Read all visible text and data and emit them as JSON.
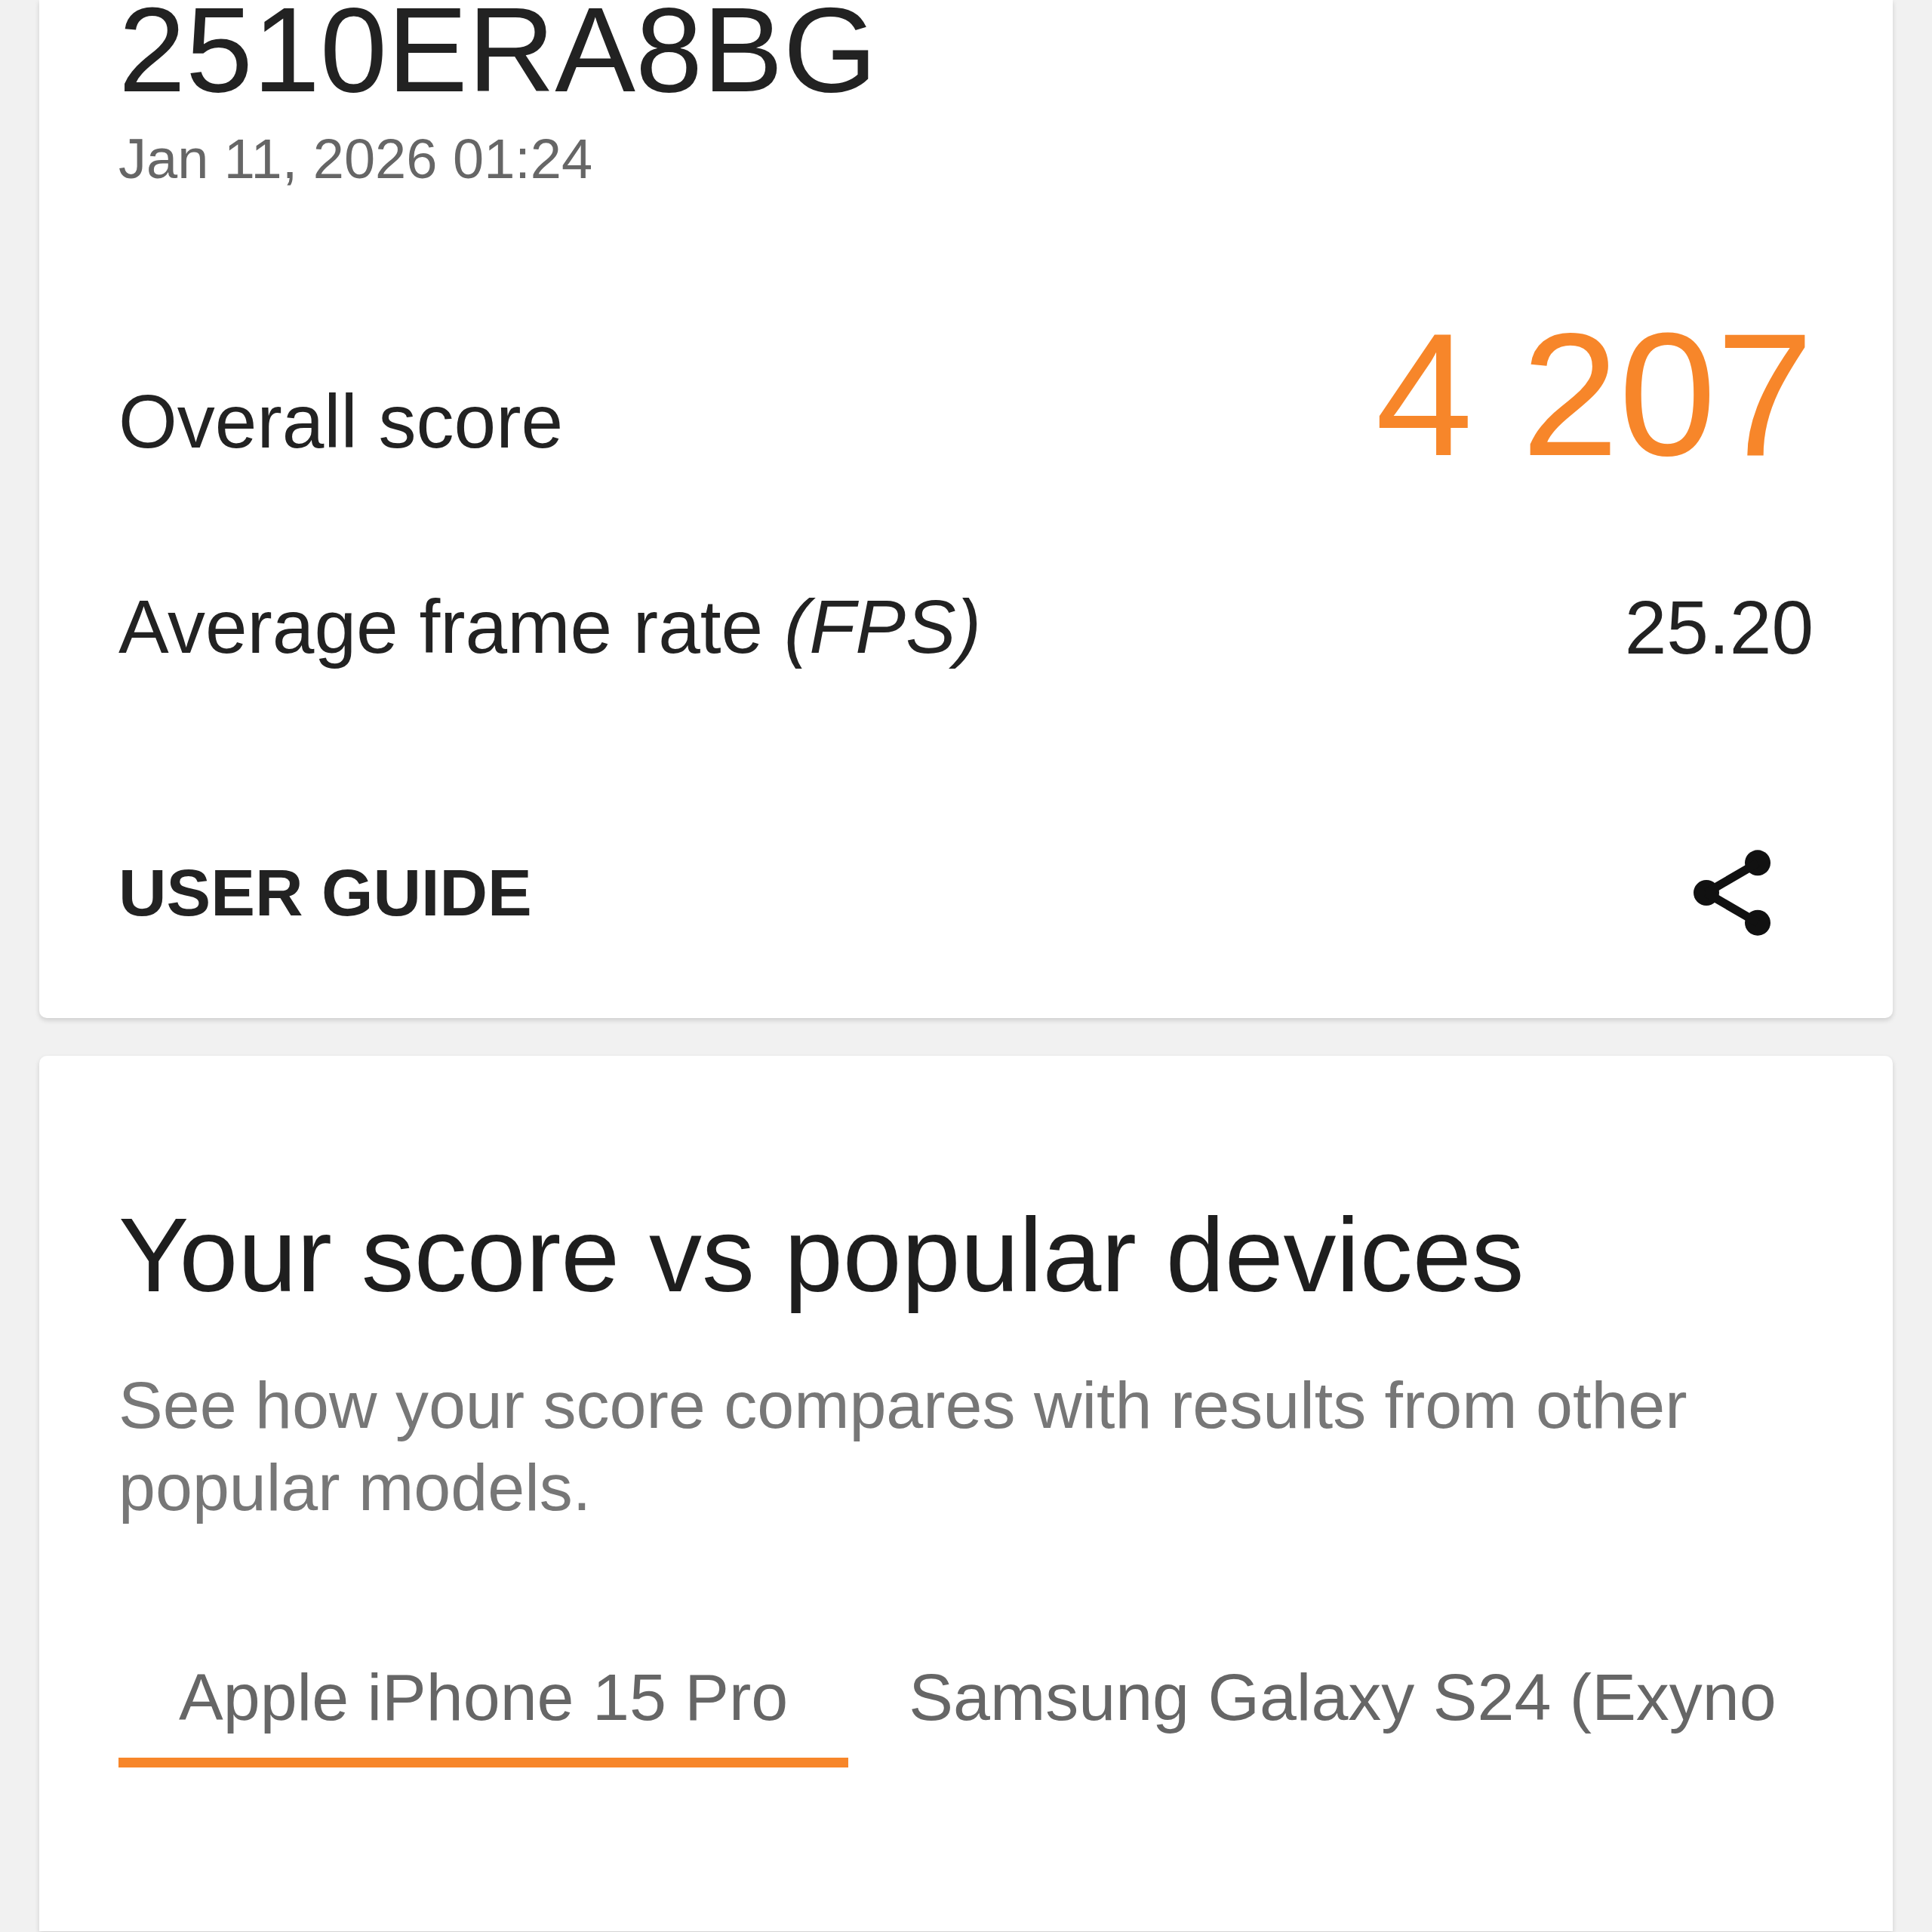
{
  "result_card": {
    "device": "2510ERA8BG",
    "date": "Jan 11, 2026 01:24",
    "metrics": [
      {
        "kind": "score",
        "label": "Overall score",
        "value": "4 207"
      },
      {
        "kind": "plain",
        "label": "Average frame rate *(FPS)*",
        "value": "25.20"
      }
    ],
    "guide_link": "USER GUIDE"
  },
  "comparison_card": {
    "title": "Your score vs popular devices",
    "description": "See how your score compares with results from other popular models.",
    "tabs": [
      {
        "label": "Apple iPhone 15 Pro",
        "selected": true
      },
      {
        "label": "Samsung Galaxy S24 (Exyno",
        "selected": false
      }
    ]
  }
}
